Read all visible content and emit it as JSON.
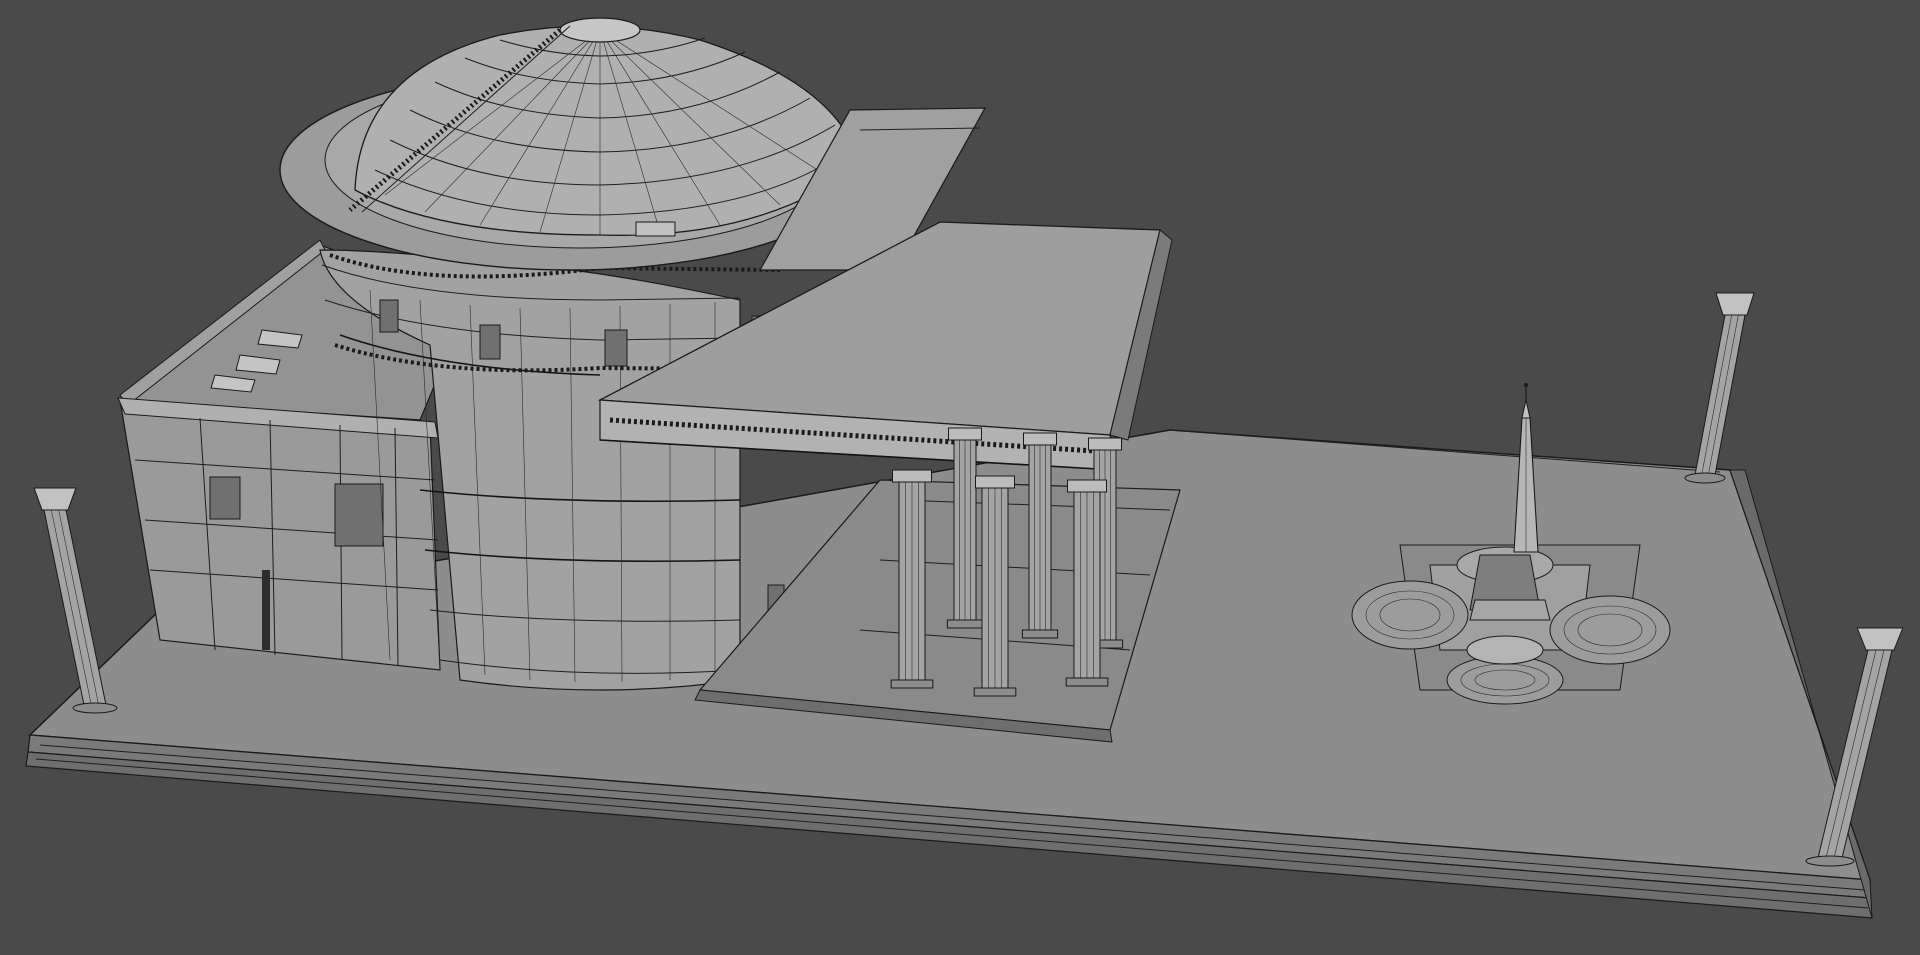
{
  "viewport": {
    "background": "#4a4a4a",
    "shading": "#8f8f8f",
    "shading_light": "#a6a6a6",
    "shading_dark": "#6e6e6e",
    "wire_color": "#1e1e1e"
  },
  "scene": {
    "objects": [
      "ground-plinth",
      "pantheon-dome",
      "pantheon-rotunda",
      "pantheon-portico",
      "portico-columns",
      "intermediate-block",
      "fountain-with-obelisk",
      "corner-column-left",
      "corner-column-right-back",
      "corner-column-right-front"
    ]
  }
}
